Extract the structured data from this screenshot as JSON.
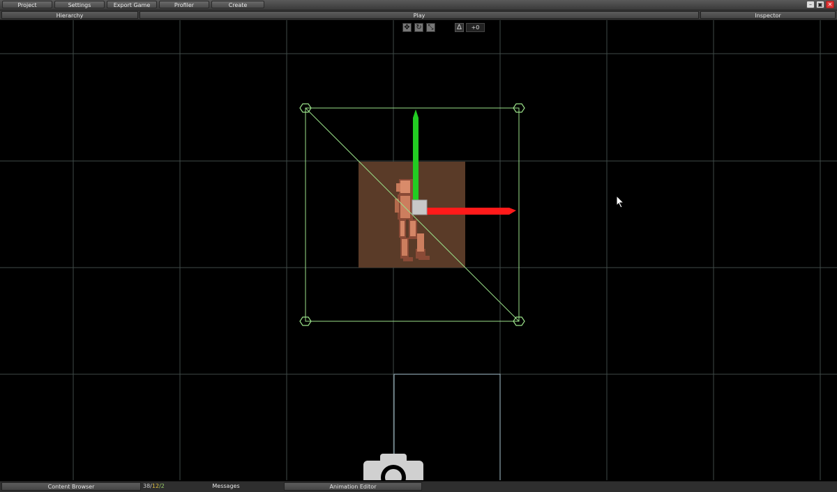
{
  "menu": {
    "project": "Project",
    "settings": "Settings",
    "export_game": "Export Game",
    "profiler": "Profiler",
    "create": "Create"
  },
  "window_controls": {
    "minimize": "–",
    "maximize": "▣",
    "close": "✕"
  },
  "panels": {
    "hierarchy": "Hierarchy",
    "play": "Play",
    "inspector": "Inspector"
  },
  "toolbar": {
    "move_icon": "move-tool-icon",
    "rotate_icon": "rotate-tool-icon",
    "scale_icon": "scale-tool-icon",
    "snap_icon": "snap-angle-icon",
    "snap_value": "+0"
  },
  "bottom": {
    "content_browser": "Content Browser",
    "stats_a": "38/",
    "stats_b": "12",
    "stats_c": "/2",
    "messages": "Messages",
    "animation_editor": "Animation Editor"
  },
  "colors": {
    "grid": "#3f4a48",
    "selection": "#9be28a",
    "gizmo_x": "#ff1a1a",
    "gizmo_y": "#22cc22",
    "sprite_bg": "#5a3b28",
    "camera_frame": "#a9c3cf"
  }
}
